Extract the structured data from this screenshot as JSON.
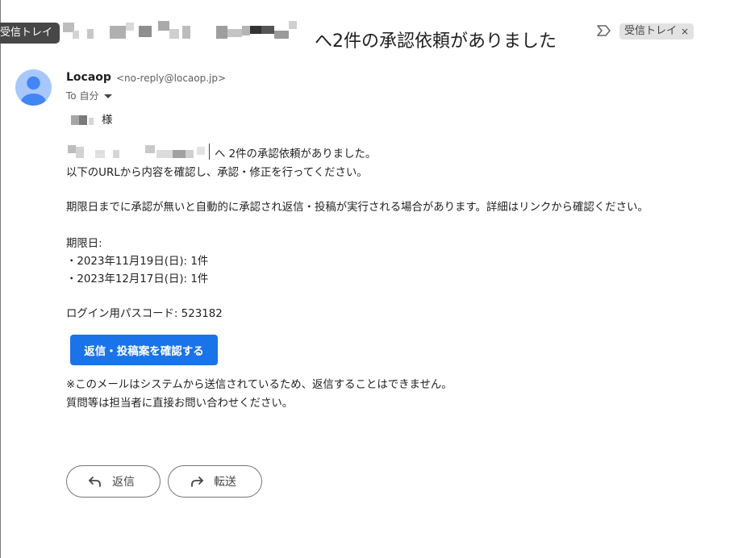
{
  "header": {
    "label_tab": "受信トレイ",
    "subject": "へ2件の承認依頼がありました",
    "label_chip": "受信トレイ",
    "chip_close": "×",
    "icons": {
      "important": "label-arrow-icon",
      "chip_close": "close-icon"
    }
  },
  "sender": {
    "name": "Locaop",
    "email": "<no-reply@locaop.jp>",
    "to_label": "To 自分",
    "avatar_icon": "default-person-avatar-icon"
  },
  "body": {
    "greeting": "様",
    "intro_1": "へ 2件の承認依頼がありました。",
    "intro_2": "以下のURLから内容を確認し、承認・修正を行ってください。",
    "notice": "期限日までに承認が無いと自動的に承認され返信・投稿が実行される場合があります。詳細はリンクから確認ください。",
    "deadline_heading": "期限日:",
    "deadlines": [
      "・2023年11月19日(日): 1件",
      "・2023年12月17日(日): 1件"
    ],
    "passcode": "ログイン用パスコード: 523182",
    "cta_label": "返信・投稿案を確認する",
    "footer_1": "※このメールはシステムから送信されているため、返信することはできません。",
    "footer_2": "質問等は担当者に直接お問い合わせください。"
  },
  "actions": {
    "reply": "返信",
    "forward": "転送",
    "icons": {
      "reply": "reply-arrow-icon",
      "forward": "forward-arrow-icon"
    }
  },
  "colors": {
    "accent": "#1a73e8",
    "avatar_bg": "#a8c7fa",
    "avatar_fg": "#4285f4",
    "label_tab_bg": "#474747",
    "chip_bg": "#e2e2e2"
  }
}
